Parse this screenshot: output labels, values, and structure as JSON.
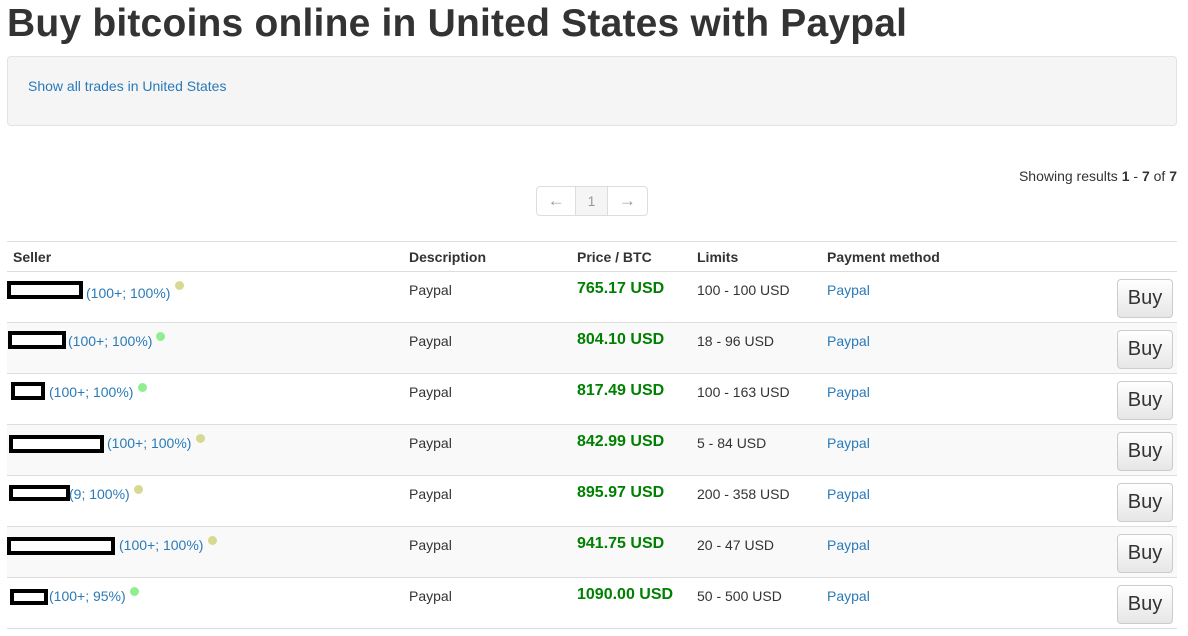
{
  "page": {
    "title": "Buy bitcoins online in United States with Paypal",
    "show_all_link": "Show all trades in United States"
  },
  "results": {
    "prefix": "Showing results ",
    "from": "1",
    "dash": " - ",
    "to": "7",
    "of": " of ",
    "total": "7"
  },
  "pagination": {
    "prev": "←",
    "current": "1",
    "next": "→"
  },
  "table": {
    "headers": {
      "seller": "Seller",
      "description": "Description",
      "price": "Price / BTC",
      "limits": "Limits",
      "payment": "Payment method"
    },
    "buy_label": "Buy",
    "rows": [
      {
        "seller_meta": "(100+; 100%)",
        "status": "yellow",
        "description": "Paypal",
        "price": "765.17 USD",
        "limits": "100 - 100 USD",
        "payment": "Paypal"
      },
      {
        "seller_meta": "(100+; 100%)",
        "status": "green",
        "description": "Paypal",
        "price": "804.10 USD",
        "limits": "18 - 96 USD",
        "payment": "Paypal"
      },
      {
        "seller_meta": "(100+; 100%)",
        "status": "green",
        "description": "Paypal",
        "price": "817.49 USD",
        "limits": "100 - 163 USD",
        "payment": "Paypal"
      },
      {
        "seller_meta": "(100+; 100%)",
        "status": "yellow",
        "description": "Paypal",
        "price": "842.99 USD",
        "limits": "5 - 84 USD",
        "payment": "Paypal"
      },
      {
        "seller_meta": "(9; 100%)",
        "status": "yellow",
        "description": "Paypal",
        "price": "895.97 USD",
        "limits": "200 - 358 USD",
        "payment": "Paypal"
      },
      {
        "seller_meta": "(100+; 100%)",
        "status": "yellow",
        "description": "Paypal",
        "price": "941.75 USD",
        "limits": "20 - 47 USD",
        "payment": "Paypal"
      },
      {
        "seller_meta": "(100+; 95%)",
        "status": "green",
        "description": "Paypal",
        "price": "1090.00 USD",
        "limits": "50 - 500 USD",
        "payment": "Paypal"
      }
    ]
  },
  "colors": {
    "link": "#2a7ab8",
    "price": "#008000",
    "status_green": "#90ee90",
    "status_yellow": "#d6d98f"
  }
}
